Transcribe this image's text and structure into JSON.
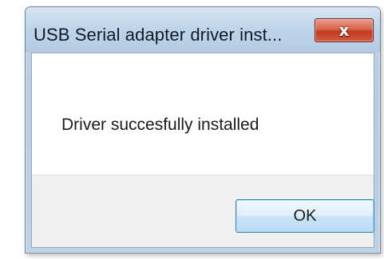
{
  "dialog": {
    "title": "USB Serial adapter driver inst...",
    "close_glyph": "x",
    "message": "Driver succesfully installed",
    "ok_label": "OK"
  },
  "icons": {
    "close": "close-icon"
  },
  "colors": {
    "close_button_red": "#c13a22",
    "frame_blue": "#b7cce2",
    "ok_button_border": "#3c7fb1"
  }
}
